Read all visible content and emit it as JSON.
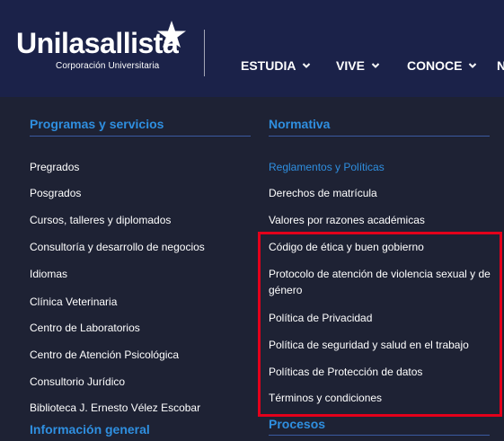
{
  "brand": {
    "name": "Unilasallista",
    "subtitle": "Corporación Universitaria",
    "star_color": "#ffffff"
  },
  "nav": {
    "items": [
      {
        "label": "ESTUDIA"
      },
      {
        "label": "VIVE"
      },
      {
        "label": "CONOCE"
      },
      {
        "label": "N"
      }
    ]
  },
  "menu": {
    "programas": {
      "title": "Programas y servicios",
      "items": [
        "Pregrados",
        "Posgrados",
        "Cursos, talleres y diplomados",
        "Consultoría y desarrollo de negocios",
        "Idiomas",
        "Clínica Veterinaria",
        "Centro de Laboratorios",
        "Centro de Atención Psicológica",
        "Consultorio Jurídico",
        "Biblioteca J. Ernesto Vélez Escobar"
      ]
    },
    "informacion": {
      "title": "Información general"
    },
    "normativa": {
      "title": "Normativa",
      "items": [
        "Reglamentos y Políticas",
        "Derechos de matrícula",
        "Valores por razones académicas",
        "Código de ética y buen gobierno",
        "Protocolo de atención de violencia sexual y de género",
        "Política de Privacidad",
        "Política de seguridad y salud en el trabajo",
        "Políticas de Protección de datos",
        "Términos y condiciones"
      ]
    },
    "procesos": {
      "title": "Procesos"
    }
  },
  "colors": {
    "header_bg": "#1b2249",
    "menu_bg": "#1e2234",
    "accent": "#2f8fe0",
    "highlight": "#e3001b"
  }
}
